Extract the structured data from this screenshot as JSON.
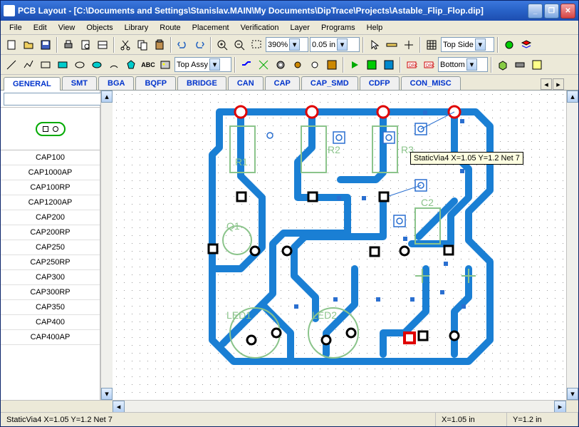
{
  "title": "PCB Layout - [C:\\Documents and Settings\\Stanislav.MAIN\\My Documents\\DipTrace\\Projects\\Astable_Flip_Flop.dip]",
  "menu": {
    "file": "File",
    "edit": "Edit",
    "view": "View",
    "objects": "Objects",
    "library": "Library",
    "route": "Route",
    "placement": "Placement",
    "verification": "Verification",
    "layer": "Layer",
    "programs": "Programs",
    "help": "Help"
  },
  "toolbar": {
    "zoom": "390%",
    "grid": "0.05 in",
    "assy": "Top Assy",
    "side": "Top Side",
    "layer": "Bottom"
  },
  "tabs": [
    "GENERAL",
    "SMT",
    "BGA",
    "BQFP",
    "BRIDGE",
    "CAN",
    "CAP",
    "CAP_SMD",
    "CDFP",
    "CON_MISC"
  ],
  "active_tab": 0,
  "components": [
    "CAP100",
    "CAP1000AP",
    "CAP100RP",
    "CAP1200AP",
    "CAP200",
    "CAP200RP",
    "CAP250",
    "CAP250RP",
    "CAP300",
    "CAP300RP",
    "CAP350",
    "CAP400",
    "CAP400AP"
  ],
  "tooltip": "StaticVia4   X=1.05  Y=1.2   Net 7",
  "status": {
    "left": "StaticVia4   X=1.05  Y=1.2   Net 7",
    "x": "X=1.05 in",
    "y": "Y=1.2 in"
  },
  "pcb": {
    "refs": [
      "R1",
      "R2",
      "R3",
      "Q1",
      "C2",
      "LED1",
      "LED2"
    ],
    "top_holes_x": [
      180,
      280,
      380,
      480
    ],
    "colors": {
      "trace": "#1a7fd4",
      "hole": "#e00000",
      "silk": "#8bc48b",
      "via": "#2a6fd0",
      "select": "#e00000"
    }
  }
}
